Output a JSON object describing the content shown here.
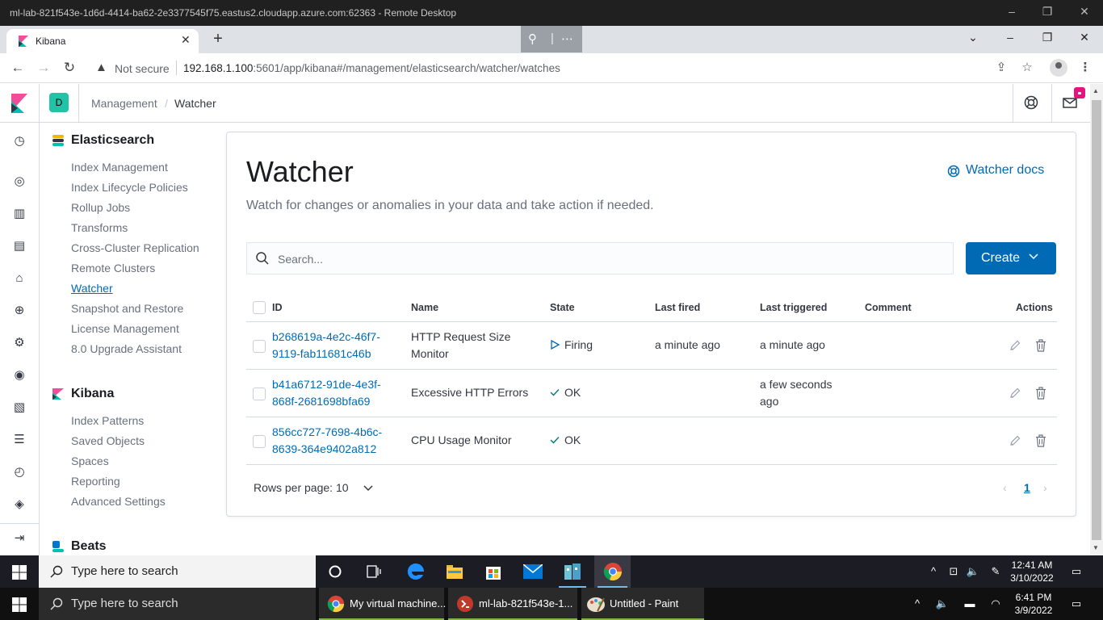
{
  "remote_desktop": {
    "title": "ml-lab-821f543e-1d6d-4414-ba62-2e3377545f75.eastus2.cloudapp.azure.com:62363 - Remote Desktop"
  },
  "browser": {
    "tab_title": "Kibana",
    "not_secure": "Not secure",
    "url_host": "192.168.1.100",
    "url_rest": ":5601/app/kibana#/management/elasticsearch/watcher/watches"
  },
  "kibana_header": {
    "space_initial": "D",
    "breadcrumb_parent": "Management",
    "breadcrumb_sep": "/",
    "breadcrumb_current": "Watcher"
  },
  "sidebar": {
    "elasticsearch": {
      "title": "Elasticsearch",
      "items": [
        "Index Management",
        "Index Lifecycle Policies",
        "Rollup Jobs",
        "Transforms",
        "Cross-Cluster Replication",
        "Remote Clusters",
        "Watcher",
        "Snapshot and Restore",
        "License Management",
        "8.0 Upgrade Assistant"
      ]
    },
    "kibana": {
      "title": "Kibana",
      "items": [
        "Index Patterns",
        "Saved Objects",
        "Spaces",
        "Reporting",
        "Advanced Settings"
      ]
    },
    "beats": {
      "title": "Beats"
    },
    "active_item": "Watcher"
  },
  "main": {
    "title": "Watcher",
    "description": "Watch for changes or anomalies in your data and take action if needed.",
    "docs_link": "Watcher docs",
    "search_placeholder": "Search...",
    "create_label": "Create",
    "columns": [
      "ID",
      "Name",
      "State",
      "Last fired",
      "Last triggered",
      "Comment",
      "Actions"
    ],
    "rows": [
      {
        "id_line1": "b268619a-4e2c-46f7-",
        "id_line2": "9119-fab11681c46b",
        "name_line1": "HTTP Request Size",
        "name_line2": "Monitor",
        "state": "Firing",
        "state_icon": "play-outline-icon",
        "last_fired": "a minute ago",
        "last_triggered_line1": "a minute ago",
        "last_triggered_line2": "",
        "comment": ""
      },
      {
        "id_line1": "b41a6712-91de-4e3f-",
        "id_line2": "868f-2681698bfa69",
        "name_line1": "Excessive HTTP Errors",
        "name_line2": "",
        "state": "OK",
        "state_icon": "check-icon",
        "last_fired": "",
        "last_triggered_line1": "a few seconds",
        "last_triggered_line2": "ago",
        "comment": ""
      },
      {
        "id_line1": "856cc727-7698-4b6c-",
        "id_line2": "8639-364e9402a812",
        "name_line1": "CPU Usage Monitor",
        "name_line2": "",
        "state": "OK",
        "state_icon": "check-icon",
        "last_fired": "",
        "last_triggered_line1": "",
        "last_triggered_line2": "",
        "comment": ""
      }
    ],
    "rows_per_page": "Rows per page: 10",
    "current_page": "1"
  },
  "taskbar_inner": {
    "search_text": "Type here to search",
    "time": "12:41 AM",
    "date": "3/10/2022"
  },
  "taskbar_outer": {
    "search_text": "Type here to search",
    "tasks": [
      "My virtual machine...",
      "ml-lab-821f543e-1...",
      "Untitled - Paint"
    ],
    "time": "6:41 PM",
    "date": "3/9/2022"
  },
  "colors": {
    "accent": "#006bb4",
    "space_badge": "#20c3a5",
    "notification": "#e7127d",
    "ok_green": "#017d73"
  }
}
